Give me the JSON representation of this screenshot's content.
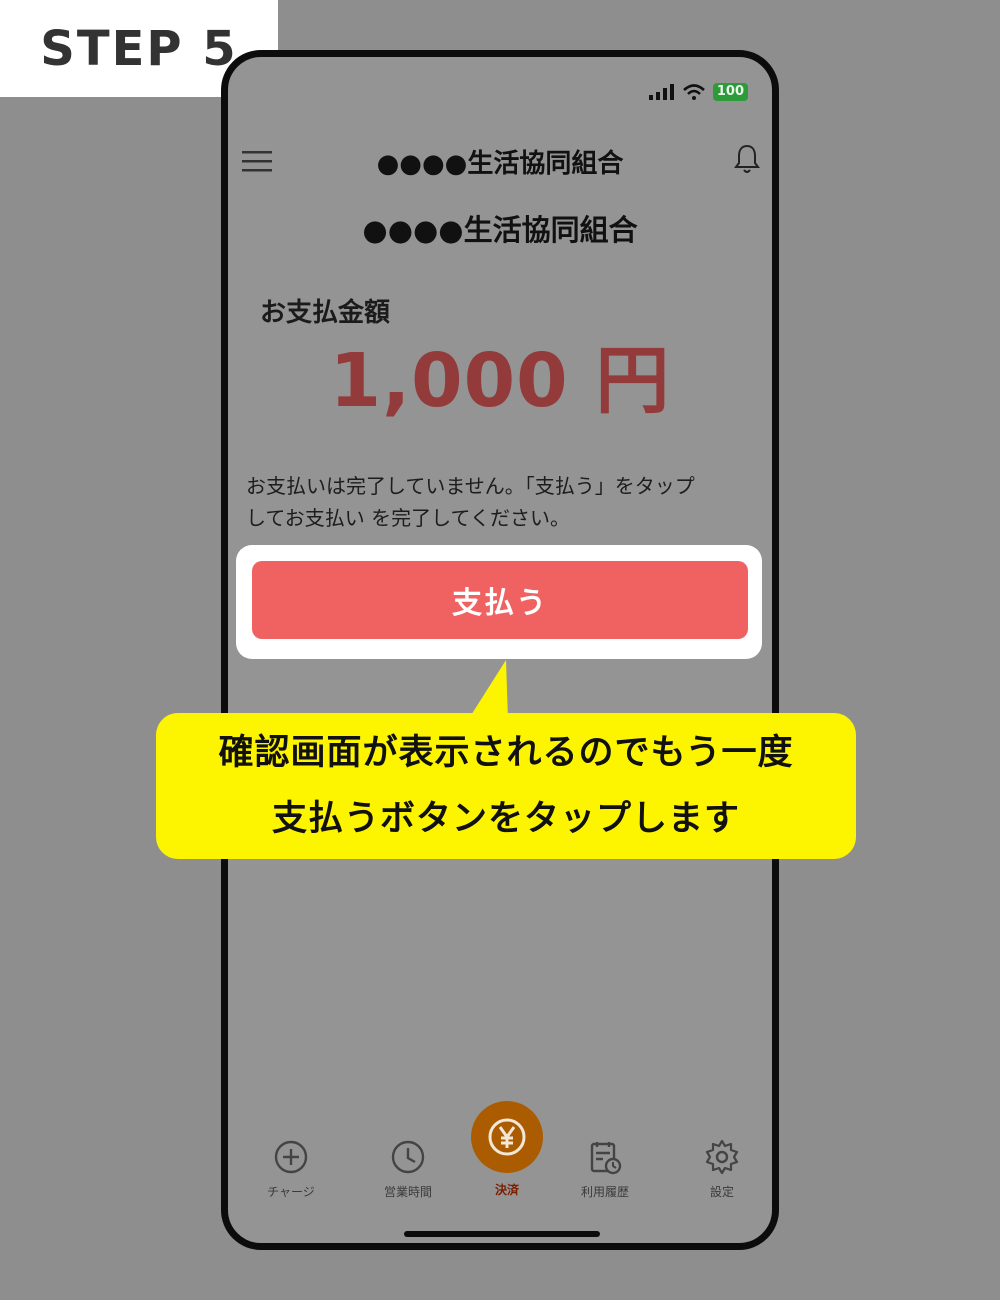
{
  "step_label": "STEP 5",
  "status": {
    "battery": "100"
  },
  "header": {
    "title": "●●●●生活協同組合"
  },
  "store": {
    "name": "●●●●生活協同組合"
  },
  "payment": {
    "amount_label": "お支払金額",
    "amount": "1,000 円",
    "message_line1": "お支払いは完了していません。「支払う」をタップ",
    "message_line2": "してお支払い を完了してください。",
    "pay_button_label": "支払う"
  },
  "callout": {
    "line1": "確認画面が表示されるのでもう一度",
    "line2": "支払うボタンをタップします"
  },
  "tabs": [
    {
      "label": "チャージ",
      "icon": "plus-circle-icon"
    },
    {
      "label": "営業時間",
      "icon": "clock-icon"
    },
    {
      "label": "決済",
      "icon": "yen-icon"
    },
    {
      "label": "利用履歴",
      "icon": "history-icon"
    },
    {
      "label": "設定",
      "icon": "gear-icon"
    }
  ],
  "colors": {
    "pay_button": "#f06161",
    "amount": "#933a3a",
    "callout": "#fdf500",
    "center_tab": "#ab5c00"
  }
}
